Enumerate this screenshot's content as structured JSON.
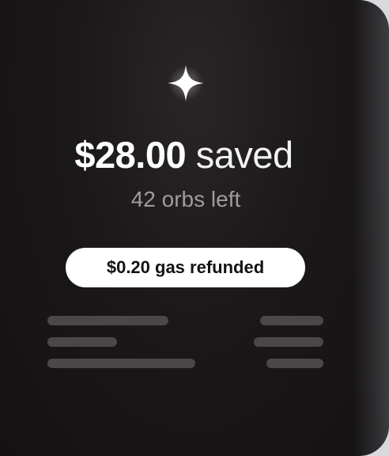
{
  "card": {
    "amount_saved": "$28.00",
    "saved_suffix": "saved",
    "orbs_left": "42 orbs left",
    "gas_refund_badge": "$0.20 gas refunded"
  },
  "icons": {
    "sparkle": "sparkle-icon"
  },
  "colors": {
    "card_background": "#1b1819",
    "headline_text": "#ffffff",
    "subline_text": "#9f9c9d",
    "badge_background": "#ffffff",
    "badge_text": "#141213",
    "placeholder_bars": "#4a4748"
  }
}
